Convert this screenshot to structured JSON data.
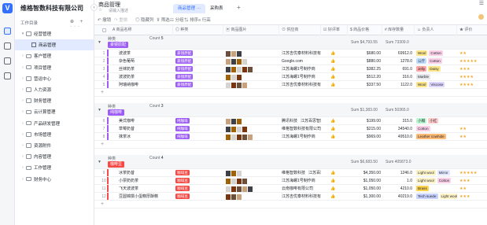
{
  "app": {
    "company": "维格智数科技有限公司",
    "directory_label": "工作目录",
    "add_tools": "⊕ + ···"
  },
  "sidebar": {
    "items": [
      {
        "label": "经营管理",
        "level": 1,
        "expanded": true,
        "type": "folder"
      },
      {
        "label": "商品管理",
        "level": 2,
        "type": "table",
        "active": true
      },
      {
        "label": "客户管理",
        "level": 1,
        "type": "folder"
      },
      {
        "label": "项目管理",
        "level": 1,
        "type": "folder"
      },
      {
        "label": "营运中心",
        "level": 1,
        "type": "folder"
      },
      {
        "label": "人力资源",
        "level": 1,
        "type": "folder"
      },
      {
        "label": "财务管理",
        "level": 1,
        "type": "folder"
      },
      {
        "label": "云计算管理",
        "level": 1,
        "type": "folder"
      },
      {
        "label": "产品研发管理",
        "level": 1,
        "type": "folder"
      },
      {
        "label": "市场管理",
        "level": 1,
        "type": "folder"
      },
      {
        "label": "资源附件",
        "level": 1,
        "type": "folder"
      },
      {
        "label": "内容管理",
        "level": 1,
        "type": "folder"
      },
      {
        "label": "工作管理",
        "level": 1,
        "type": "folder"
      },
      {
        "label": "财务中心",
        "level": 1,
        "type": "folder"
      }
    ]
  },
  "doc": {
    "title": "商品管理",
    "description": "请输入描述"
  },
  "tabs": [
    {
      "label": "商品管理",
      "active": true,
      "more": "···"
    },
    {
      "label": "采购表",
      "active": false
    }
  ],
  "toolbar": {
    "undo": "撤销",
    "redo": "重做",
    "hide": "隐藏列",
    "filter": "筛选",
    "group": "分组",
    "sort": "排序",
    "row_height": "行高"
  },
  "columns": [
    "商品名称",
    "种类",
    "商品图片",
    "供应商",
    "好评率",
    "商品价格",
    "库存数量",
    "负责人",
    "评价"
  ],
  "groups": [
    {
      "field_label": "种类",
      "value": "豪镜原配",
      "color": "#9c5cf5",
      "count_label": "Count",
      "count": "5",
      "sum_price": "Sum $4,793.55",
      "sum_stock": "Sum 73309.0",
      "rows": [
        {
          "n": "1",
          "name": "波波茶",
          "kind": "豪镜原配",
          "supplier": "江苏吉优泰材料科技有限公司",
          "price": "$680.00",
          "stock": "69912.0",
          "tags": [
            "Wool",
            "Cotton"
          ],
          "stars": "★★"
        },
        {
          "n": "2",
          "name": "杂色葡萄",
          "kind": "豪镜原配",
          "supplier": "Google.com",
          "price": "$880.00",
          "stock": "1278.0",
          "tags": [
            "公斤",
            "Cotton"
          ],
          "stars": "★★★★★"
        },
        {
          "n": "3",
          "name": "丝袜奶茶",
          "kind": "豪镜原配",
          "supplier": "江苏海螺1号制作商",
          "price": "$382.25",
          "stock": "691.0",
          "tags": [
            "Jelly",
            "Daisy"
          ],
          "stars": "★★★"
        },
        {
          "n": "4",
          "name": "波波奶茶",
          "kind": "豪镜原配",
          "supplier": "江苏海螺1号制作商",
          "price": "$512.20",
          "stock": "316.0",
          "tags": [
            "Marble"
          ],
          "stars": "★★★★"
        },
        {
          "n": "5",
          "name": "阿瑞纳咖啡",
          "kind": "豪镜原配",
          "supplier": "江苏吉优泰材料科技有限公司",
          "price": "$337.50",
          "stock": "1122.0",
          "tags": [
            "Wool",
            "Viscose"
          ],
          "stars": "★★★★"
        }
      ]
    },
    {
      "field_label": "种类",
      "value": "纯咖啡",
      "color": "#9c5cf5",
      "count_label": "Count",
      "count": "3",
      "sum_price": "Sum $1,383.00",
      "sum_stock": "Sum 50365.0",
      "rows": [
        {
          "n": "6",
          "name": "美式咖啡",
          "kind": "纯咖啡",
          "supplier": "腾讯科技",
          "supplier2": "江苏百思智能",
          "price": "$199.00",
          "stock": "315.0",
          "tags": [
            "小帽",
            "小红"
          ],
          "stars": ""
        },
        {
          "n": "7",
          "name": "草莓奶昔",
          "kind": "纯咖啡",
          "supplier": "维格智数科技有限公司",
          "price": "$215.00",
          "stock": "34540.0",
          "tags": [
            "Cotton"
          ],
          "stars": "★★"
        },
        {
          "n": "8",
          "name": "抹茶冰",
          "kind": "纯咖啡",
          "supplier": "江苏海螺1号制作商",
          "price": "$969.00",
          "stock": "49510.0",
          "tags": [
            "Leather cowhide"
          ],
          "stars": "★★"
        }
      ]
    },
    {
      "field_label": "种类",
      "value": "咖啡豆",
      "color": "#f54a45",
      "count_label": "Count",
      "count": "4",
      "sum_price": "Sum $6,683.50",
      "sum_stock": "Sum 405873.0",
      "rows": [
        {
          "n": "9",
          "name": "冰茶奶昔",
          "kind": "咖啡豆",
          "supplier": "维格智数科技",
          "supplier2": "江苏百思智",
          "price": "$4,350.00",
          "stock": "1246.0",
          "tags": [
            "Light wool",
            "Mirror"
          ],
          "stars": "★★★★★"
        },
        {
          "n": "10",
          "name": "小票奶奶茶",
          "kind": "咖啡豆",
          "supplier": "江苏海螺1号制作商",
          "price": "$1,050.00",
          "stock": "1.0",
          "tags": [
            "Light wool",
            "Cotton"
          ],
          "stars": "★★★"
        },
        {
          "n": "11",
          "name": "飞天波波茶",
          "kind": "咖啡豆",
          "supplier": "云南咖啡有限公司",
          "price": "$1,050.00",
          "stock": "4210.0",
          "tags": [
            "Brass"
          ],
          "stars": "★★"
        },
        {
          "n": "12",
          "name": "豆圆锦撰小蛋糕厚酥糕",
          "kind": "咖啡豆",
          "supplier": "江苏吉优泰材料科技有限公司",
          "price": "$1,300.00",
          "stock": "40219.0",
          "tags": [
            "Tech suede",
            "Light wool"
          ],
          "stars": "★★★"
        }
      ]
    }
  ],
  "colors": {
    "accent": "#3370ff",
    "purple": "#9c5cf5",
    "red": "#f54a45"
  }
}
